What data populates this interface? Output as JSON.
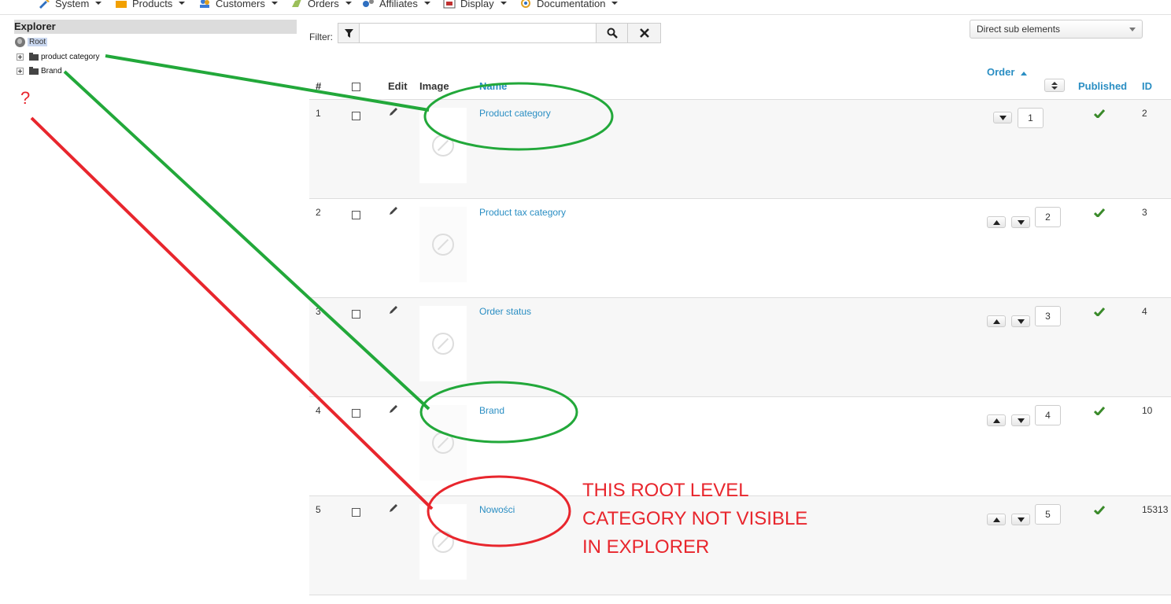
{
  "menu": [
    {
      "label": "System",
      "icon": "tools-icon",
      "color": "#2f6fc0"
    },
    {
      "label": "Products",
      "icon": "box-icon",
      "color": "#f2a000"
    },
    {
      "label": "Customers",
      "icon": "users-icon",
      "color": "#3a7bd5"
    },
    {
      "label": "Orders",
      "icon": "orders-icon",
      "color": "#7aa940"
    },
    {
      "label": "Affiliates",
      "icon": "affiliates-icon",
      "color": "#2f6fc0"
    },
    {
      "label": "Display",
      "icon": "display-icon",
      "color": "#c03030"
    },
    {
      "label": "Documentation",
      "icon": "documentation-icon",
      "color": "#e0a020"
    }
  ],
  "explorer": {
    "title": "Explorer",
    "root": "Root",
    "nodes": [
      "product category",
      "Brand"
    ]
  },
  "filter": {
    "label": "Filter:",
    "value": "",
    "placeholder": ""
  },
  "view_select": {
    "selected": "Direct sub elements"
  },
  "table": {
    "headers": {
      "num": "#",
      "edit": "Edit",
      "image": "Image",
      "name": "Name",
      "order": "Order",
      "published": "Published",
      "id": "ID"
    },
    "rows": [
      {
        "num": "1",
        "name": "Product category",
        "order": "1",
        "published": true,
        "id": "2"
      },
      {
        "num": "2",
        "name": "Product tax category",
        "order": "2",
        "published": true,
        "id": "3"
      },
      {
        "num": "3",
        "name": "Order status",
        "order": "3",
        "published": true,
        "id": "4"
      },
      {
        "num": "4",
        "name": "Brand",
        "order": "4",
        "published": true,
        "id": "10"
      },
      {
        "num": "5",
        "name": "Nowości",
        "order": "5",
        "published": true,
        "id": "15313"
      }
    ]
  },
  "annotation": {
    "question": "?",
    "lines": [
      "THIS ROOT LEVEL",
      "CATEGORY NOT VISIBLE",
      "IN EXPLORER"
    ],
    "color_red": "#e8262d",
    "color_green": "#22a83a"
  },
  "colors": {
    "link": "#2a8ec3",
    "check": "#3a8a2a"
  }
}
